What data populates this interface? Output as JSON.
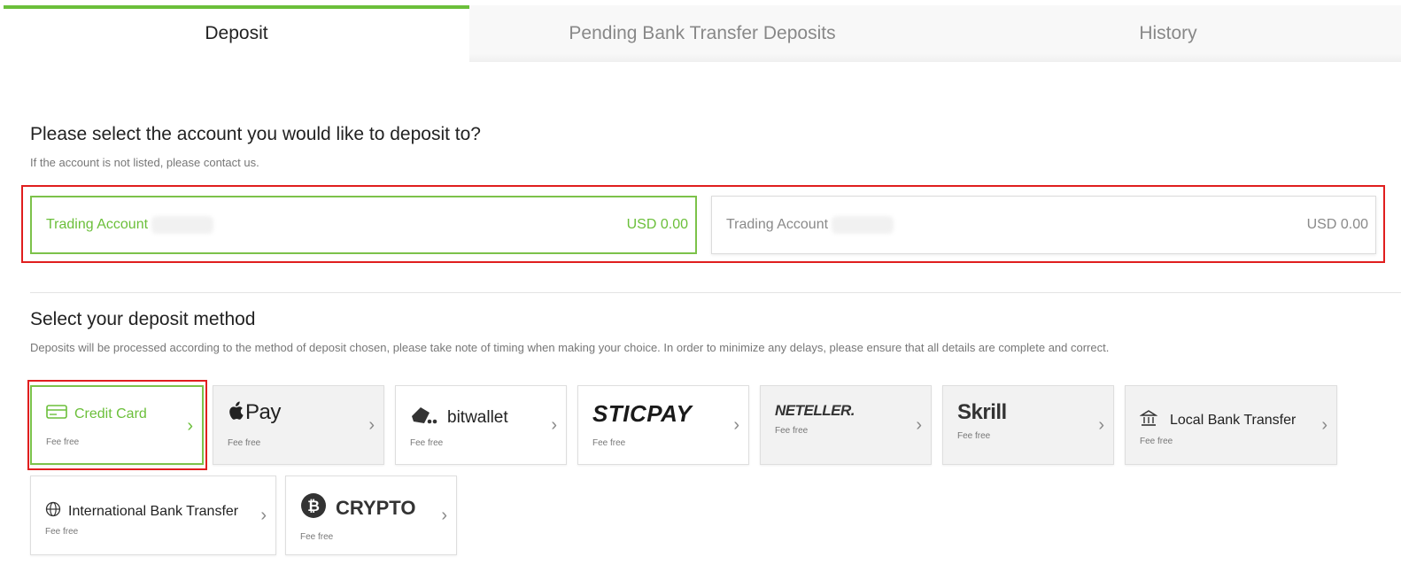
{
  "tabs": [
    {
      "label": "Deposit",
      "active": true
    },
    {
      "label": "Pending Bank Transfer Deposits",
      "active": false
    },
    {
      "label": "History",
      "active": false
    }
  ],
  "account_section": {
    "title": "Please select the account you would like to deposit to?",
    "subtitle": "If the account is not listed, please contact us.",
    "accounts": [
      {
        "label": "Trading Account",
        "balance": "USD 0.00",
        "selected": true
      },
      {
        "label": "Trading Account",
        "balance": "USD 0.00",
        "selected": false
      }
    ]
  },
  "method_section": {
    "title": "Select your deposit method",
    "subtitle": "Deposits will be processed according to the method of deposit chosen, please take note of timing when making your choice. In order to minimize any delays, please ensure that all details are complete and correct.",
    "methods": [
      {
        "label": "Credit Card",
        "fee": "Fee free",
        "icon": "credit-card-icon",
        "selected": true
      },
      {
        "label": "Pay",
        "fee": "Fee free",
        "icon": "apple-icon",
        "selected": false
      },
      {
        "label": "bitwallet",
        "fee": "Fee free",
        "icon": "bitwallet-icon",
        "selected": false
      },
      {
        "label": "STICPAY",
        "fee": "Fee free",
        "icon": "sticpay-logo",
        "selected": false
      },
      {
        "label": "NETELLER.",
        "fee": "Fee free",
        "icon": "neteller-logo",
        "selected": false
      },
      {
        "label": "Skrill",
        "fee": "Fee free",
        "icon": "skrill-logo",
        "selected": false
      },
      {
        "label": "Local Bank Transfer",
        "fee": "Fee free",
        "icon": "bank-icon",
        "selected": false
      },
      {
        "label": "International Bank Transfer",
        "fee": "Fee free",
        "icon": "globe-icon",
        "selected": false
      },
      {
        "label": "CRYPTO",
        "fee": "Fee free",
        "icon": "bitcoin-icon",
        "selected": false
      }
    ]
  },
  "colors": {
    "accent": "#6bbf3a",
    "highlight": "#e01e1e"
  }
}
